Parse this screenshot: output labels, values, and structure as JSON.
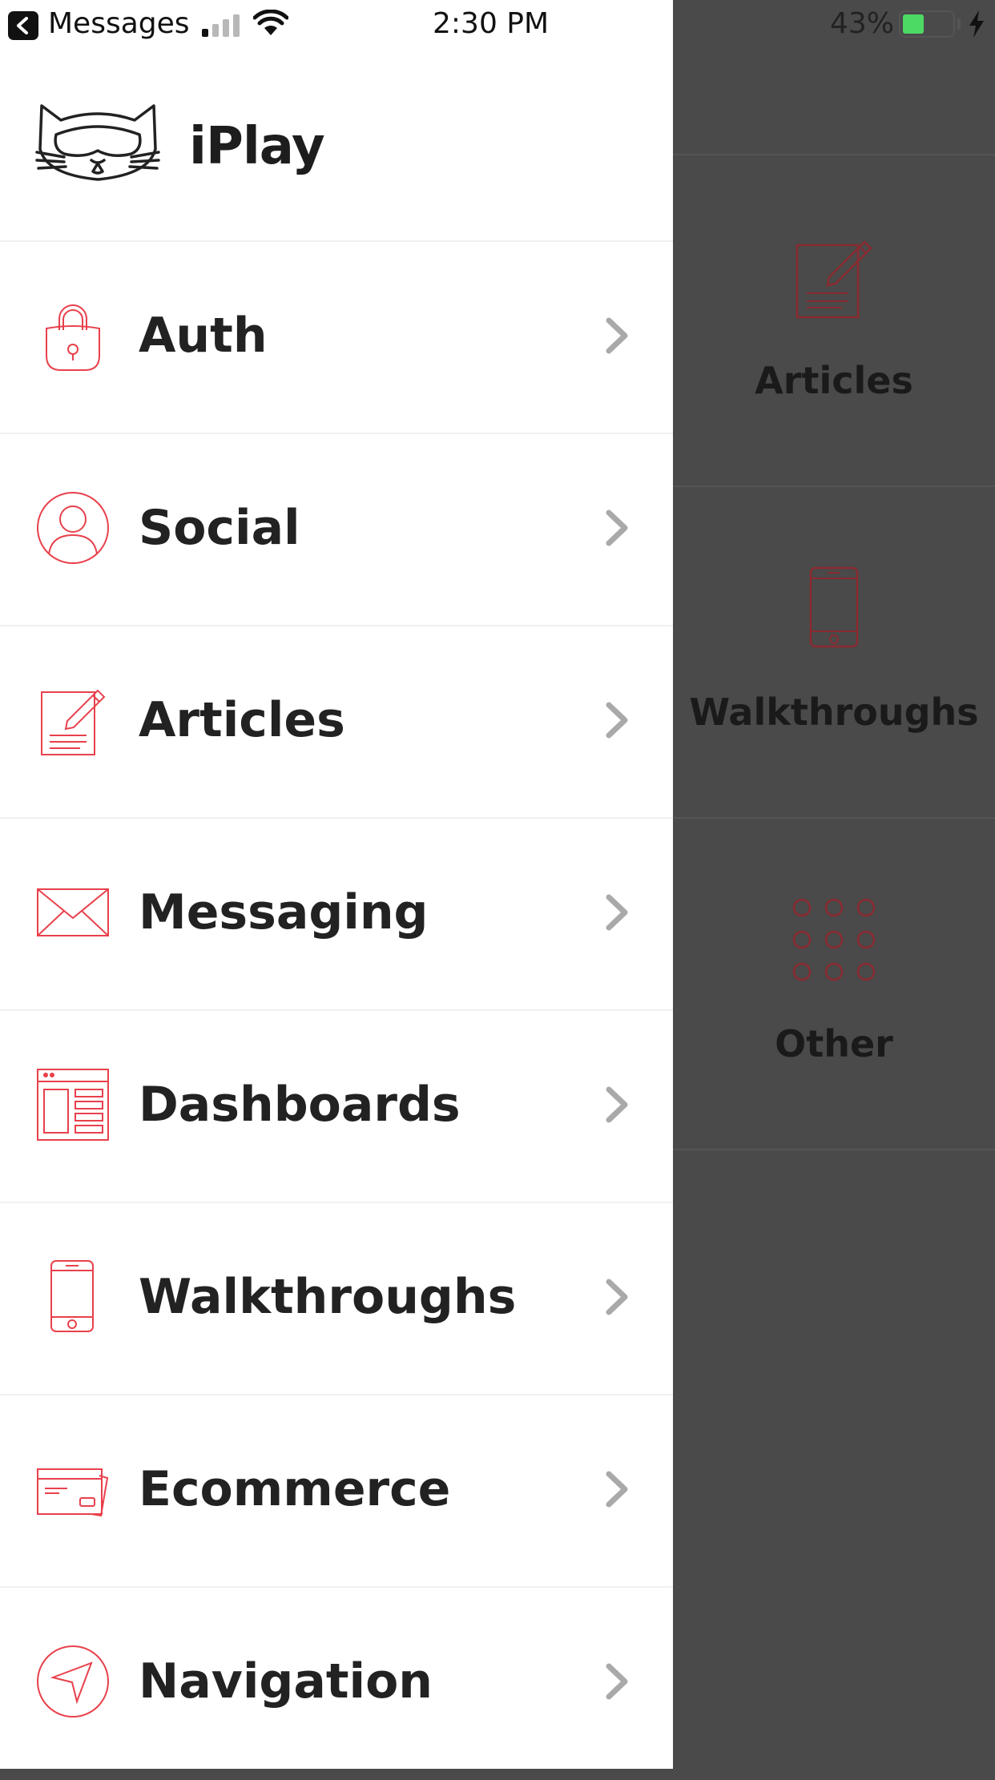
{
  "status_bar": {
    "back_app": "Messages",
    "time": "2:30 PM",
    "battery": "43%",
    "battery_level": 0.43
  },
  "app": {
    "name": "iPlay"
  },
  "menu": [
    {
      "label": "Auth",
      "icon": "lock-icon"
    },
    {
      "label": "Social",
      "icon": "user-icon"
    },
    {
      "label": "Articles",
      "icon": "article-icon"
    },
    {
      "label": "Messaging",
      "icon": "envelope-icon"
    },
    {
      "label": "Dashboards",
      "icon": "dashboard-icon"
    },
    {
      "label": "Walkthroughs",
      "icon": "phone-icon"
    },
    {
      "label": "Ecommerce",
      "icon": "credit-card-icon"
    },
    {
      "label": "Navigation",
      "icon": "navigation-icon"
    }
  ],
  "background_tiles": [
    {
      "label": "Articles",
      "icon": "article-icon"
    },
    {
      "label": "Walkthroughs",
      "icon": "phone-icon"
    },
    {
      "label": "Other",
      "icon": "grid-icon"
    }
  ],
  "colors": {
    "accent": "#e8414c",
    "overlay": "#4a4a4a",
    "text": "#222222",
    "battery": "#4cd964"
  }
}
